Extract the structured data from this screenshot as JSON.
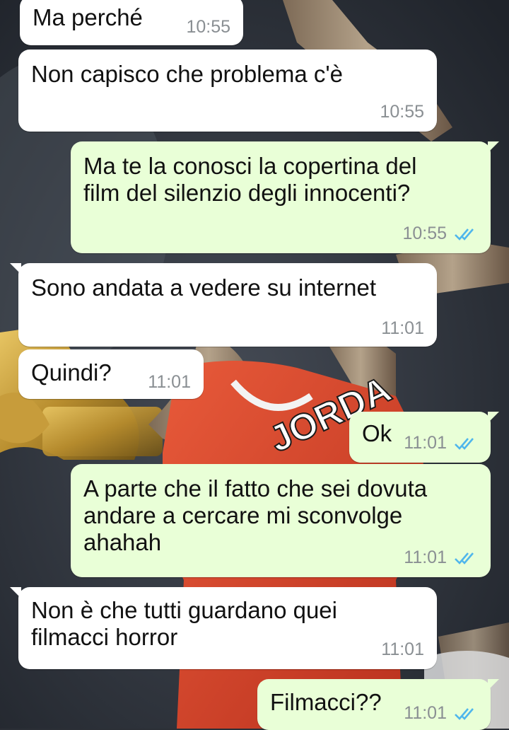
{
  "colors": {
    "incoming_bubble": "#ffffff",
    "outgoing_bubble": "#e9ffd7",
    "read_ticks": "#4fb6ec",
    "timestamp": "#8a8f93"
  },
  "wallpaper": {
    "jersey_text": "JORDA"
  },
  "messages": [
    {
      "direction": "incoming",
      "text": "Ma perché",
      "time": "10:55"
    },
    {
      "direction": "incoming",
      "text": "Non capisco che problema c'è",
      "time": "10:55"
    },
    {
      "direction": "outgoing",
      "text": "Ma te la conosci la copertina del\nfilm del silenzio degli innocenti?",
      "time": "10:55",
      "ticks": "double-check-read-icon"
    },
    {
      "direction": "incoming",
      "text": "Sono andata a vedere su internet",
      "time": "11:01"
    },
    {
      "direction": "incoming",
      "text": "Quindi?",
      "time": "11:01"
    },
    {
      "direction": "outgoing",
      "text": "Ok",
      "time": "11:01",
      "ticks": "double-check-read-icon"
    },
    {
      "direction": "outgoing",
      "text": "A parte che il fatto che sei dovuta\nandare a cercare mi sconvolge\nahahah",
      "time": "11:01",
      "ticks": "double-check-read-icon"
    },
    {
      "direction": "incoming",
      "text": "Non è che tutti guardano quei\nfilmacci horror",
      "time": "11:01"
    },
    {
      "direction": "outgoing",
      "text": "Filmacci??",
      "time": "11:01",
      "ticks": "double-check-read-icon"
    }
  ]
}
